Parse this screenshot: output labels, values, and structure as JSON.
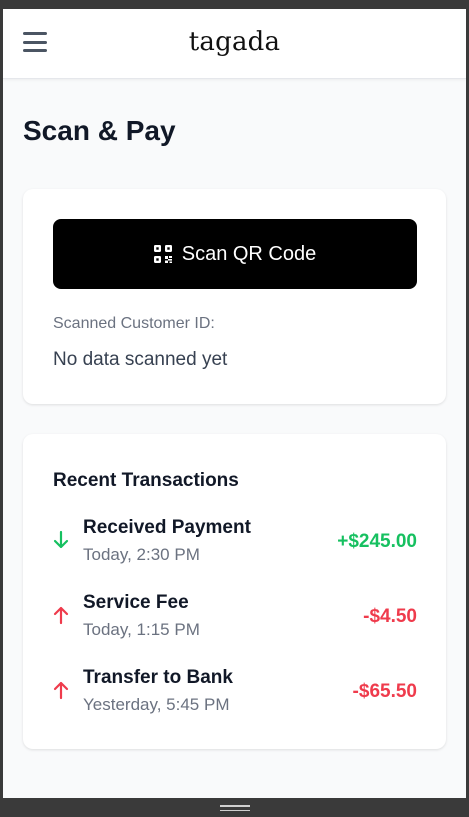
{
  "header": {
    "brand": "tagada"
  },
  "page": {
    "title": "Scan & Pay"
  },
  "scan": {
    "button_label": "Scan QR Code",
    "customer_id_label": "Scanned Customer ID:",
    "customer_id_value": "No data scanned yet"
  },
  "transactions": {
    "title": "Recent Transactions",
    "items": [
      {
        "name": "Received Payment",
        "time": "Today, 2:30 PM",
        "amount": "+$245.00",
        "direction": "incoming",
        "icon": "arrow-down-icon",
        "color": "#16c060"
      },
      {
        "name": "Service Fee",
        "time": "Today, 1:15 PM",
        "amount": "-$4.50",
        "direction": "outgoing",
        "icon": "arrow-up-icon",
        "color": "#ef3b4c"
      },
      {
        "name": "Transfer to Bank",
        "time": "Yesterday, 5:45 PM",
        "amount": "-$65.50",
        "direction": "outgoing",
        "icon": "arrow-up-icon",
        "color": "#ef3b4c"
      }
    ]
  },
  "colors": {
    "primary_button": "#000000",
    "positive": "#16c060",
    "negative": "#ef3b4c",
    "background": "#f9fafb"
  }
}
